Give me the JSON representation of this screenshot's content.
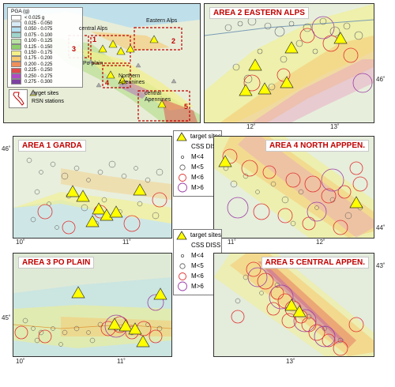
{
  "overview": {
    "pga_title": "PGA (g)",
    "pga_classes": [
      {
        "label": "< 0.025 g",
        "color": "#ffffff"
      },
      {
        "label": "0.025 - 0.050",
        "color": "#d9ecf6"
      },
      {
        "label": "0.050 - 0.075",
        "color": "#b3dff0"
      },
      {
        "label": "0.075 - 0.100",
        "color": "#9fd4cc"
      },
      {
        "label": "0.100 - 0.125",
        "color": "#b9e1a4"
      },
      {
        "label": "0.125 - 0.150",
        "color": "#8fd06c"
      },
      {
        "label": "0.150 - 0.175",
        "color": "#f3f08a"
      },
      {
        "label": "0.175 - 0.200",
        "color": "#f7c870"
      },
      {
        "label": "0.200 - 0.225",
        "color": "#ef8f5a"
      },
      {
        "label": "0.225 - 0.250",
        "color": "#e14b4b"
      },
      {
        "label": "0.250 - 0.275",
        "color": "#b04ac4"
      },
      {
        "label": "0.275 - 0.300",
        "color": "#7d3fa0"
      }
    ],
    "legend_target": "target sites",
    "legend_rsn": "RSN stations",
    "labels": {
      "central_alps": "central Alps",
      "eastern_alps": "Eastern Alps",
      "po_plain": "Po plain",
      "northern_apennines": "Northern Apennines",
      "central_apennines": "central Apennines"
    },
    "area_numbers": [
      "1",
      "2",
      "3",
      "4",
      "5"
    ]
  },
  "legend_a": {
    "items": [
      "target sites",
      "CSS DISS",
      "M<4",
      "M<5",
      "M<6",
      "M>6"
    ]
  },
  "legend_b": {
    "items": [
      "target sites",
      "CSS DISS",
      "M<4",
      "M<5",
      "M<6",
      "M>6"
    ]
  },
  "panels": {
    "area2": {
      "title": "AREA 2 EASTERN ALPS",
      "xticks": [
        "12˚",
        "13˚"
      ],
      "yticks": [
        "46˚"
      ]
    },
    "area1": {
      "title": "AREA 1 GARDA",
      "xticks": [
        "10˚",
        "11˚"
      ],
      "yticks": [
        "46˚"
      ]
    },
    "area4": {
      "title": "AREA 4 NORTH APPPEN.",
      "xticks": [
        "11˚",
        "12˚"
      ],
      "yticks": [
        "44˚"
      ]
    },
    "area3": {
      "title": "AREA 3 PO PLAIN",
      "xticks": [
        "10˚",
        "11˚"
      ],
      "yticks": [
        "45˚"
      ]
    },
    "area5": {
      "title": "AREA 5 CENTRAL APPEN.",
      "xticks": [
        "13˚"
      ],
      "yticks": [
        "43˚"
      ]
    }
  },
  "colors": {
    "title_red": "#c00000",
    "target_fill": "#ffff00",
    "m6_red": "#e03030",
    "m_gt6_purple": "#9b3fa6"
  }
}
